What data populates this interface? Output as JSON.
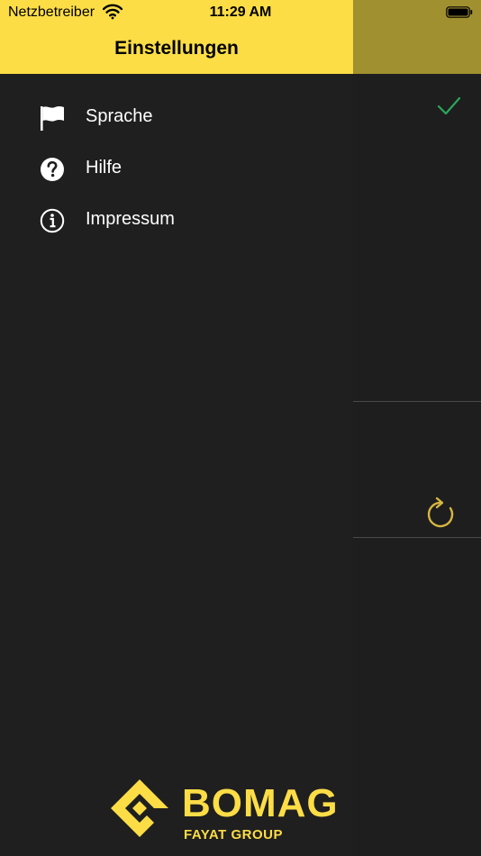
{
  "status_bar": {
    "carrier": "Netzbetreiber",
    "time": "11:29 AM"
  },
  "drawer": {
    "title": "Einstellungen",
    "items": [
      {
        "label": "Sprache",
        "icon": "flag-icon"
      },
      {
        "label": "Hilfe",
        "icon": "help-icon"
      },
      {
        "label": "Impressum",
        "icon": "info-icon"
      }
    ]
  },
  "logo": {
    "wordmark": "BOMAG",
    "subtitle": "FAYAT GROUP"
  },
  "colors": {
    "brand_yellow": "#fcdd46",
    "background": "#1f1f1f",
    "check_green": "#2aa85a",
    "dimmed_header": "#a1902f"
  }
}
